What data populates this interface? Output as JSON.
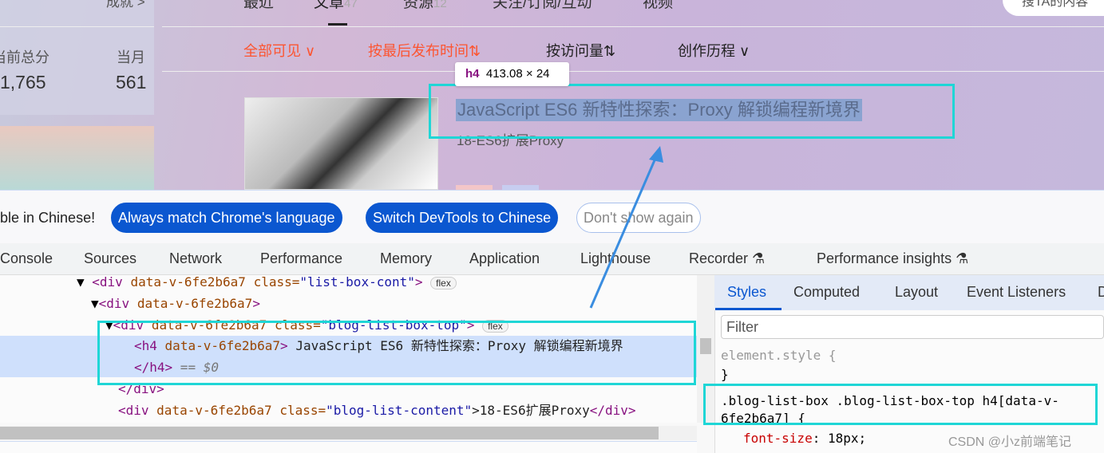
{
  "profile": {
    "achievement_link": "成就 >",
    "total_label": "当前总分",
    "total_value": "1,765",
    "month_label": "当月",
    "month_value": "561"
  },
  "nav_tabs": [
    {
      "label": "最近",
      "count": ""
    },
    {
      "label": "文章",
      "count": "47"
    },
    {
      "label": "资源",
      "count": "12"
    },
    {
      "label": "关注/订阅/互动",
      "count": ""
    },
    {
      "label": "视频",
      "count": ""
    }
  ],
  "search": {
    "placeholder": "搜TA的内容"
  },
  "filters": [
    "全部可见 ∨",
    "按最后发布时间⇅",
    "按访问量⇅",
    "创作历程 ∨"
  ],
  "article": {
    "title": "JavaScript ES6 新特性探索：Proxy 解锁编程新境界",
    "subtitle": "18-ES6扩展Proxy"
  },
  "inspect_tooltip": {
    "tag": "h4",
    "size": "413.08 × 24"
  },
  "infobar": {
    "message": "ble in Chinese!",
    "buttons": [
      "Always match Chrome's language",
      "Switch DevTools to Chinese",
      "Don't show again"
    ]
  },
  "devtools_tabs": [
    "Console",
    "Sources",
    "Network",
    "Performance",
    "Memory",
    "Application",
    "Lighthouse",
    "Recorder ⚗",
    "Performance insights ⚗"
  ],
  "elements": {
    "l1": {
      "open": "<div",
      "attr": "data-v-6fe2b6a7",
      "cls_attr": "class=",
      "cls_val": "\"list-box-cont\"",
      "close": ">",
      "badge": "flex"
    },
    "l2": {
      "open": "<div",
      "attr": "data-v-6fe2b6a7",
      "close": ">"
    },
    "l3": {
      "open": "<div",
      "attr": "data-v-6fe2b6a7",
      "cls_attr": "class=",
      "cls_val": "\"blog-list-box-top\"",
      "close": ">",
      "badge": "flex"
    },
    "l4": {
      "open": "<h4",
      "attr": "data-v-6fe2b6a7",
      "close": ">",
      "text": " JavaScript ES6 新特性探索：Proxy 解锁编程新境界"
    },
    "l5": {
      "close": "</h4>",
      "eq": " == $0"
    },
    "l6": {
      "close": "</div>"
    },
    "l7": {
      "open": "<div",
      "attr": "data-v-6fe2b6a7",
      "cls_attr": "class=",
      "cls_val": "\"blog-list-content\"",
      "text": ">18-ES6扩展Proxy",
      "close": "</div>"
    }
  },
  "styles_tabs": [
    "Styles",
    "Computed",
    "Layout",
    "Event Listeners",
    "D"
  ],
  "styles": {
    "filter_placeholder": "Filter",
    "element_style": "element.style {",
    "close_brace": "}",
    "selector": ".blog-list-box .blog-list-box-top h4[data-v-6fe2b6a7] {",
    "prop": "font-size",
    "value": "18px;"
  },
  "watermark": "CSDN @小z前端笔记",
  "colors": {
    "accent_red": "#fc5531",
    "devtools_blue": "#0b57d0",
    "highlight": "#1fd6d6"
  }
}
